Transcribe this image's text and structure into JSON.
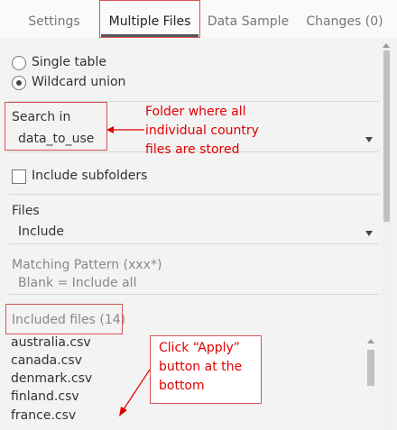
{
  "tabs": [
    {
      "label": "Settings"
    },
    {
      "label": "Multiple Files"
    },
    {
      "label": "Data Sample"
    },
    {
      "label": "Changes (0)"
    }
  ],
  "union_mode": {
    "options": [
      {
        "label": "Single table",
        "selected": false
      },
      {
        "label": "Wildcard union",
        "selected": true
      }
    ]
  },
  "search_in": {
    "label": "Search in",
    "value": "data_to_use"
  },
  "include_subfolders": {
    "label": "Include subfolders",
    "checked": false
  },
  "files": {
    "label": "Files",
    "value": "Include"
  },
  "matching_pattern": {
    "label": "Matching Pattern (xxx*)",
    "placeholder": "Blank = Include all"
  },
  "included_files": {
    "label": "Included files (14)",
    "items": [
      "australia.csv",
      "canada.csv",
      "denmark.csv",
      "finland.csv",
      "france.csv"
    ]
  },
  "annotations": {
    "folder_note": [
      "Folder where all",
      "individual country",
      "files are stored"
    ],
    "apply_note": [
      "Click “Apply”",
      "button at the",
      "bottom"
    ],
    "color": "#e00000"
  }
}
